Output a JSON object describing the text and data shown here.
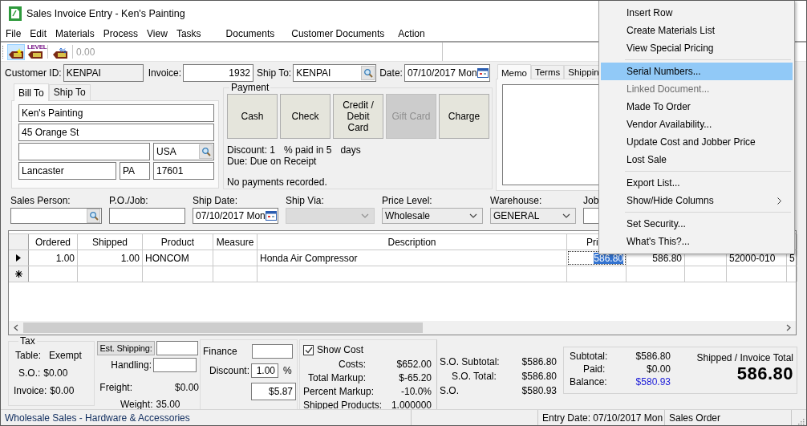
{
  "window": {
    "title": "Sales Invoice Entry - Ken's Painting"
  },
  "menu_bar": [
    "File",
    "Edit",
    "Materials",
    "Process",
    "View",
    "Tasks",
    "Documents",
    "Customer Documents",
    "Action"
  ],
  "toolbar": {
    "buttons": [
      {
        "kind": "new",
        "selected": true
      },
      {
        "kind": "level",
        "caption": "LEVEL",
        "selected": false
      },
      {
        "kind": "percent",
        "selected": false
      }
    ],
    "amount": "0.00"
  },
  "header": {
    "customer_id": {
      "label": "Customer ID:",
      "value": "KENPAI"
    },
    "invoice": {
      "label": "Invoice:",
      "value": "1932"
    },
    "ship_to": {
      "label": "Ship To:",
      "value": "KENPAI"
    },
    "date": {
      "label": "Date:",
      "value": "07/10/2017 Mon"
    }
  },
  "address_tabs": [
    {
      "label": "Bill To",
      "selected": true
    },
    {
      "label": "Ship To",
      "selected": false
    }
  ],
  "address": {
    "name": "Ken's Painting",
    "street": "45 Orange St",
    "country": "USA",
    "city": "Lancaster",
    "state": "PA",
    "zip": "17601"
  },
  "payment": {
    "title": "Payment",
    "buttons": [
      {
        "label": "Cash",
        "disabled": false
      },
      {
        "label": "Check",
        "disabled": false
      },
      {
        "label": "Credit / Debit Card",
        "disabled": false
      },
      {
        "label": "Gift Card",
        "disabled": true
      },
      {
        "label": "Charge",
        "disabled": false
      }
    ],
    "terms": [
      "Discount: 1",
      "% paid in 5",
      "days"
    ],
    "due": "Due: Due on Receipt",
    "status": "No payments recorded."
  },
  "notes_tabs": [
    {
      "label": "Memo",
      "selected": true
    },
    {
      "label": "Terms",
      "selected": false
    },
    {
      "label": "Shippin",
      "selected": false
    }
  ],
  "order_fields": [
    {
      "label": "Sales Person:",
      "kind": "lookup",
      "disabled": false
    },
    {
      "label": "P.O./Job:",
      "kind": "text",
      "disabled": false
    },
    {
      "label": "Ship Date:",
      "kind": "date",
      "value": "07/10/2017 Mon",
      "disabled": false
    },
    {
      "label": "Ship Via:",
      "kind": "combo",
      "disabled": true
    },
    {
      "label": "Price Level:",
      "kind": "combo",
      "value": "Wholesale",
      "disabled": false
    },
    {
      "label": "Warehouse:",
      "kind": "combo",
      "value": "GENERAL",
      "disabled": false
    },
    {
      "label": "Job",
      "kind": "text",
      "disabled": false
    }
  ],
  "grid": {
    "columns": [
      "Ordered",
      "Shipped",
      "Product",
      "Measure",
      "Description",
      "Pri"
    ],
    "rows": [
      {
        "current": true,
        "cells": [
          {
            "text": "1.00",
            "selected": false
          },
          {
            "text": "1.00",
            "selected": false
          },
          {
            "text": "HONCOM",
            "selected": false
          },
          {
            "selected": false
          },
          {
            "text": "Honda Air Compressor",
            "selected": false
          },
          {
            "text": "586.80",
            "selected": true
          },
          {
            "text": "586.80",
            "selected": false
          },
          {
            "selected": false
          },
          {
            "text": "52000-010",
            "selected": false
          },
          {
            "text": "5",
            "selected": false
          }
        ]
      }
    ],
    "new_row": true
  },
  "tax": {
    "title": "Tax",
    "rows": [
      {
        "label": "Table:",
        "value": "Exempt"
      },
      {
        "label": "S.O.:",
        "value": "$0.00"
      },
      {
        "label": "Invoice:",
        "value": "$0.00"
      }
    ]
  },
  "shipping": {
    "estimate_button": "Est. Shipping:",
    "handling_label": "Handling:",
    "freight_label": "Freight:",
    "freight": "$0.00",
    "weight_label": "Weight:",
    "weight": "35.00"
  },
  "finance": {
    "label": "Finance",
    "discount_label": "Discount:",
    "discount": "1.00",
    "percent": "%",
    "amount": "$5.87"
  },
  "cost": {
    "show_cost": {
      "label": "Show Cost",
      "checked": true
    },
    "rows": [
      {
        "label": "Costs:",
        "value": "$652.00"
      },
      {
        "label": "Total Markup:",
        "value": "$-65.20"
      },
      {
        "label": "Percent Markup:",
        "value": "-10.0%"
      },
      {
        "label": "Shipped Products:",
        "value": "1.000000"
      }
    ]
  },
  "so_totals": [
    {
      "label": "S.O. Subtotal:",
      "value": "$586.80"
    },
    {
      "label": "S.O. Total:",
      "value": "$586.80"
    },
    {
      "label": "S.O.",
      "value": "$580.93"
    }
  ],
  "totals": {
    "rows": [
      {
        "label": "Subtotal:",
        "value": "$586.80",
        "highlight": false
      },
      {
        "label": "Paid:",
        "value": "$0.00",
        "highlight": false
      },
      {
        "label": "Balance:",
        "value": "$580.93",
        "highlight": true
      }
    ],
    "caption": "Shipped / Invoice Total",
    "total": "586.80"
  },
  "status_bar": [
    "Wholesale Sales - Hardware & Accessories",
    "Entry Date: 07/10/2017 Mon",
    "Sales Order"
  ],
  "context_menu": [
    {
      "label": "Insert Row",
      "selected": false,
      "disabled": false,
      "submenu": false,
      "separator_after": false
    },
    {
      "label": "Create Materials List",
      "selected": false,
      "disabled": false,
      "submenu": false,
      "separator_after": false
    },
    {
      "label": "View Special Pricing",
      "selected": false,
      "disabled": false,
      "submenu": false,
      "separator_after": true
    },
    {
      "label": "Serial Numbers...",
      "selected": true,
      "disabled": false,
      "submenu": false,
      "separator_after": false
    },
    {
      "label": "Linked Document...",
      "selected": false,
      "disabled": true,
      "submenu": false,
      "separator_after": false
    },
    {
      "label": "Made To Order",
      "selected": false,
      "disabled": false,
      "submenu": false,
      "separator_after": false
    },
    {
      "label": "Vendor Availability...",
      "selected": false,
      "disabled": false,
      "submenu": false,
      "separator_after": false
    },
    {
      "label": "Update Cost and Jobber Price",
      "selected": false,
      "disabled": false,
      "submenu": false,
      "separator_after": false
    },
    {
      "label": "Lost Sale",
      "selected": false,
      "disabled": false,
      "submenu": false,
      "separator_after": true
    },
    {
      "label": "Export List...",
      "selected": false,
      "disabled": false,
      "submenu": false,
      "separator_after": false
    },
    {
      "label": "Show/Hide Columns",
      "selected": false,
      "disabled": false,
      "submenu": true,
      "separator_after": true
    },
    {
      "label": "Set Security...",
      "selected": false,
      "disabled": false,
      "submenu": false,
      "separator_after": false
    },
    {
      "label": "What's This?...",
      "selected": false,
      "disabled": false,
      "submenu": false,
      "separator_after": false
    }
  ]
}
